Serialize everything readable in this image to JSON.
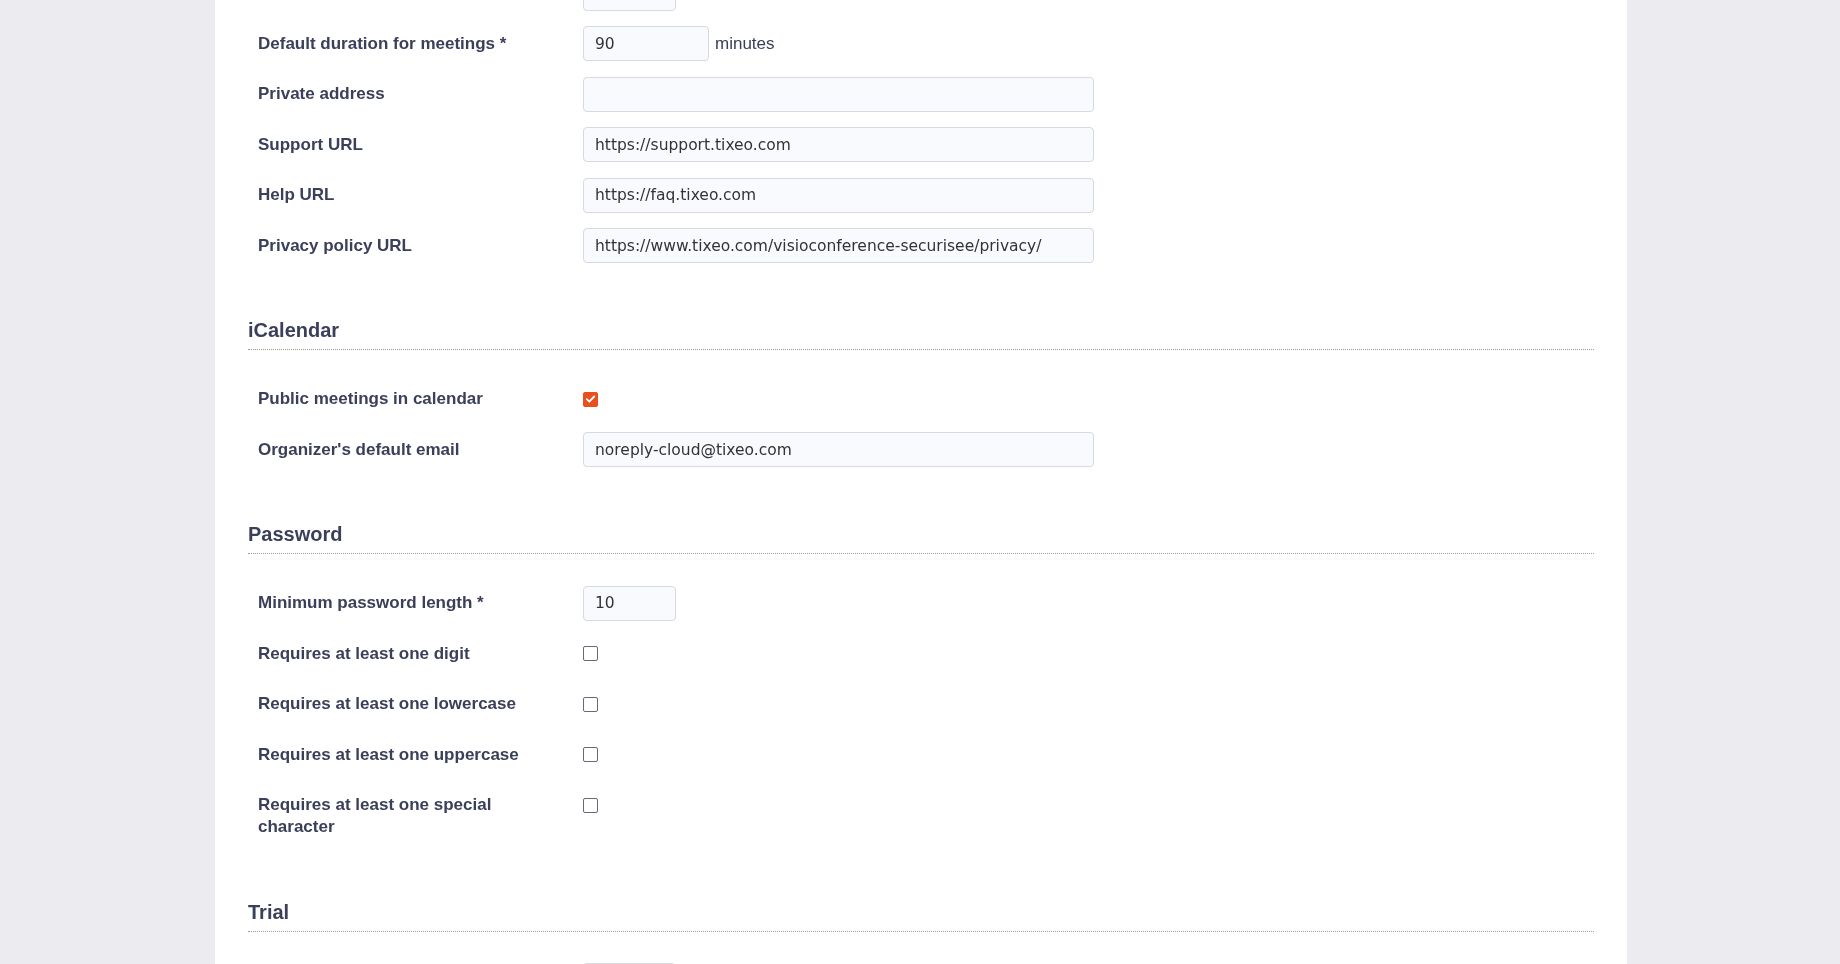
{
  "general_fields": [
    {
      "kind": "select_clipped"
    },
    {
      "kind": "number_unit",
      "label": "Default duration for meetings *",
      "value": "90",
      "unit": "minutes"
    },
    {
      "kind": "text",
      "label": "Private address"
    },
    {
      "kind": "text",
      "label": "Support URL",
      "value": "https://support.tixeo.com"
    },
    {
      "kind": "text",
      "label": "Help URL",
      "value": "https://faq.tixeo.com"
    },
    {
      "kind": "text",
      "label": "Privacy policy URL",
      "value": "https://www.tixeo.com/visioconference-securisee/privacy/"
    }
  ],
  "sections": [
    {
      "title": "iCalendar",
      "fields": [
        {
          "kind": "checkbox",
          "label": "Public meetings in calendar",
          "checked": true
        },
        {
          "kind": "text",
          "label": "Organizer's default email",
          "value": "noreply-cloud@tixeo.com"
        }
      ]
    },
    {
      "title": "Password",
      "fields": [
        {
          "kind": "short",
          "label": "Minimum password length *",
          "value": "10"
        },
        {
          "kind": "checkbox",
          "label": "Requires at least one digit",
          "checked": false
        },
        {
          "kind": "checkbox",
          "label": "Requires at least one lowercase",
          "checked": false
        },
        {
          "kind": "checkbox",
          "label": "Requires at least one uppercase",
          "checked": false
        },
        {
          "kind": "checkbox",
          "label": "Requires at least one special character",
          "checked": false
        }
      ]
    },
    {
      "title": "Trial",
      "fields": [
        {
          "kind": "short"
        }
      ]
    }
  ]
}
